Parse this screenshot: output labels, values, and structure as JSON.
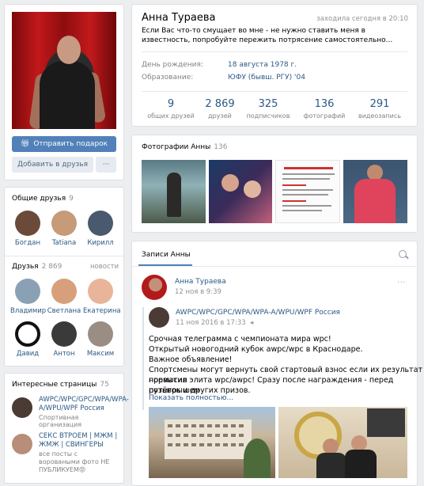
{
  "profile": {
    "name": "Анна Тураева",
    "last_seen": "заходила сегодня в 20:10",
    "status": "Если Вас что-то смущает во мне - не нужно ставить меня в известность, попробуйте пережить потрясение самостоятельно...",
    "birthday_label": "День рождения:",
    "birthday_value": "18 августа 1978 г.",
    "education_label": "Образование:",
    "education_value": "ЮФУ (бывш. РГУ) '04"
  },
  "buttons": {
    "gift": "Отправить подарок",
    "add_friend": "Добавить в друзья",
    "more": "···"
  },
  "stats": [
    {
      "num": "9",
      "label": "общих друзей"
    },
    {
      "num": "2 869",
      "label": "друзей"
    },
    {
      "num": "325",
      "label": "подписчиков"
    },
    {
      "num": "136",
      "label": "фотографий"
    },
    {
      "num": "291",
      "label": "видеозапись"
    }
  ],
  "mutual_friends": {
    "title": "Общие друзья",
    "count": "9",
    "items": [
      {
        "name": "Богдан",
        "color": "#6b4a3a"
      },
      {
        "name": "Tatiana",
        "color": "#c79a78"
      },
      {
        "name": "Кирилл",
        "color": "#4a5a6e"
      }
    ]
  },
  "friends": {
    "title": "Друзья",
    "count": "2 869",
    "extra": "новости",
    "items": [
      {
        "name": "Владимир",
        "color": "#8aa0b4"
      },
      {
        "name": "Светлана",
        "color": "#d8a07a"
      },
      {
        "name": "Екатерина",
        "color": "#e8b59a"
      },
      {
        "name": "Давид",
        "color": "#111111"
      },
      {
        "name": "Антон",
        "color": "#3a3a3a"
      },
      {
        "name": "Максим",
        "color": "#9a8e84"
      }
    ]
  },
  "interesting": {
    "title": "Интересные страницы",
    "count": "75",
    "items": [
      {
        "name": "AWPC/WPC/GPC/WPA/WPA-A/WPU/WPF Россия",
        "desc": "Спортивная организация"
      },
      {
        "name": "СЕКС ВТРОЕМ | МЖМ | ЖМЖ | СВИНГЕРЫ",
        "desc": "все посты с вороваными фото НЕ ПУБЛИКУЕМ😡"
      }
    ]
  },
  "photos": {
    "title": "Фотографии Анны",
    "count": "136"
  },
  "wall": {
    "title": "Записи Анны",
    "post_author": "Анна Тураева",
    "post_date": "12 ноя в 9:39",
    "repost_author": "AWPC/WPC/GPC/WPA/WPA-A/WPU/WPF Россия",
    "repost_date": "11 ноя 2016 в 17:33",
    "lines": [
      "Срочная телеграмма с чемпионата мира wpc!",
      "Открытый новогодний кубок awpc/wpc в Краснодаре.",
      "Важное объявление!",
      "Спортсмены могут вернуть свой стартовый взнос если их результат превысил",
      "норматив элита wpc/awpc! Сразу после награждения - перед розыгрышем",
      "путёвок и других призов."
    ],
    "show_more": "Показать полностью..."
  }
}
